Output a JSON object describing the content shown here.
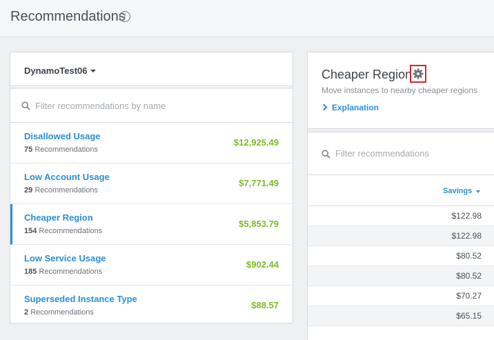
{
  "page": {
    "title": "Recommendations"
  },
  "account": {
    "name": "DynamoTest06"
  },
  "filter": {
    "placeholder": "Filter recommendations by name"
  },
  "recommendations": [
    {
      "title": "Disallowed Usage",
      "count": "75",
      "count_label": "Recommendations",
      "amount": "$12,925.49"
    },
    {
      "title": "Low Account Usage",
      "count": "29",
      "count_label": "Recommendations",
      "amount": "$7,771.49"
    },
    {
      "title": "Cheaper Region",
      "count": "154",
      "count_label": "Recommendations",
      "amount": "$5,853.79",
      "active": true
    },
    {
      "title": "Low Service Usage",
      "count": "185",
      "count_label": "Recommendations",
      "amount": "$902.44"
    },
    {
      "title": "Superseded Instance Type",
      "count": "2",
      "count_label": "Recommendations",
      "amount": "$88.57"
    }
  ],
  "detail": {
    "title": "Cheaper Region",
    "subtitle": "Move instances to nearby cheaper regions",
    "explanation": "Explanation",
    "filter_placeholder": "Filter recommendations",
    "savings_header": "Savings",
    "savings": [
      "$122.98",
      "$122.98",
      "$80.52",
      "$80.52",
      "$70.27",
      "$65.15"
    ]
  },
  "colors": {
    "accent": "#2a8fd6",
    "money": "#7cbb2a",
    "highlight": "#e3221c"
  }
}
